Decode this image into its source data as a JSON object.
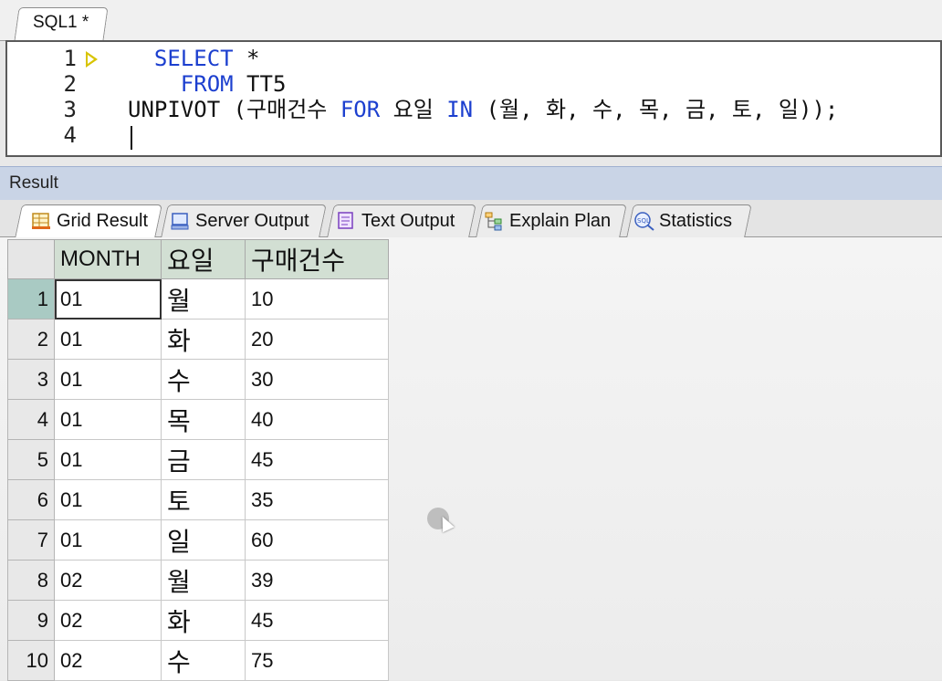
{
  "editor_tab": {
    "label": "SQL1 *"
  },
  "editor": {
    "line_numbers": [
      "1",
      "2",
      "3",
      "4"
    ],
    "lines": [
      {
        "parts": [
          {
            "text": "  ",
            "kw": false
          },
          {
            "text": "SELECT",
            "kw": true
          },
          {
            "text": " *",
            "kw": false
          }
        ]
      },
      {
        "parts": [
          {
            "text": "    ",
            "kw": false
          },
          {
            "text": "FROM",
            "kw": true
          },
          {
            "text": " TT5",
            "kw": false
          }
        ]
      },
      {
        "parts": [
          {
            "text": "UNPIVOT (구매건수 ",
            "kw": false
          },
          {
            "text": "FOR",
            "kw": true
          },
          {
            "text": " 요일 ",
            "kw": false
          },
          {
            "text": "IN",
            "kw": true
          },
          {
            "text": " (월, 화, 수, 목, 금, 토, 일));",
            "kw": false
          }
        ]
      },
      {
        "parts": []
      }
    ],
    "keyword_color": "#1c3fcf"
  },
  "result": {
    "title": "Result",
    "tabs": [
      {
        "label": "Grid Result",
        "icon": "grid-icon",
        "active": true
      },
      {
        "label": "Server Output",
        "icon": "server-icon",
        "active": false
      },
      {
        "label": "Text Output",
        "icon": "text-output-icon",
        "active": false
      },
      {
        "label": "Explain Plan",
        "icon": "explain-plan-icon",
        "active": false
      },
      {
        "label": "Statistics",
        "icon": "statistics-icon",
        "active": false
      }
    ]
  },
  "grid": {
    "columns": [
      "MONTH",
      "요일",
      "구매건수"
    ],
    "rows": [
      {
        "num": "1",
        "month": "01",
        "day": "월",
        "count": "10"
      },
      {
        "num": "2",
        "month": "01",
        "day": "화",
        "count": "20"
      },
      {
        "num": "3",
        "month": "01",
        "day": "수",
        "count": "30"
      },
      {
        "num": "4",
        "month": "01",
        "day": "목",
        "count": "40"
      },
      {
        "num": "5",
        "month": "01",
        "day": "금",
        "count": "45"
      },
      {
        "num": "6",
        "month": "01",
        "day": "토",
        "count": "35"
      },
      {
        "num": "7",
        "month": "01",
        "day": "일",
        "count": "60"
      },
      {
        "num": "8",
        "month": "02",
        "day": "월",
        "count": "39"
      },
      {
        "num": "9",
        "month": "02",
        "day": "화",
        "count": "45"
      },
      {
        "num": "10",
        "month": "02",
        "day": "수",
        "count": "75"
      }
    ],
    "selected_row": "1",
    "header_color": "#d2dfd3",
    "selected_rownum_color": "#a9cac3"
  }
}
